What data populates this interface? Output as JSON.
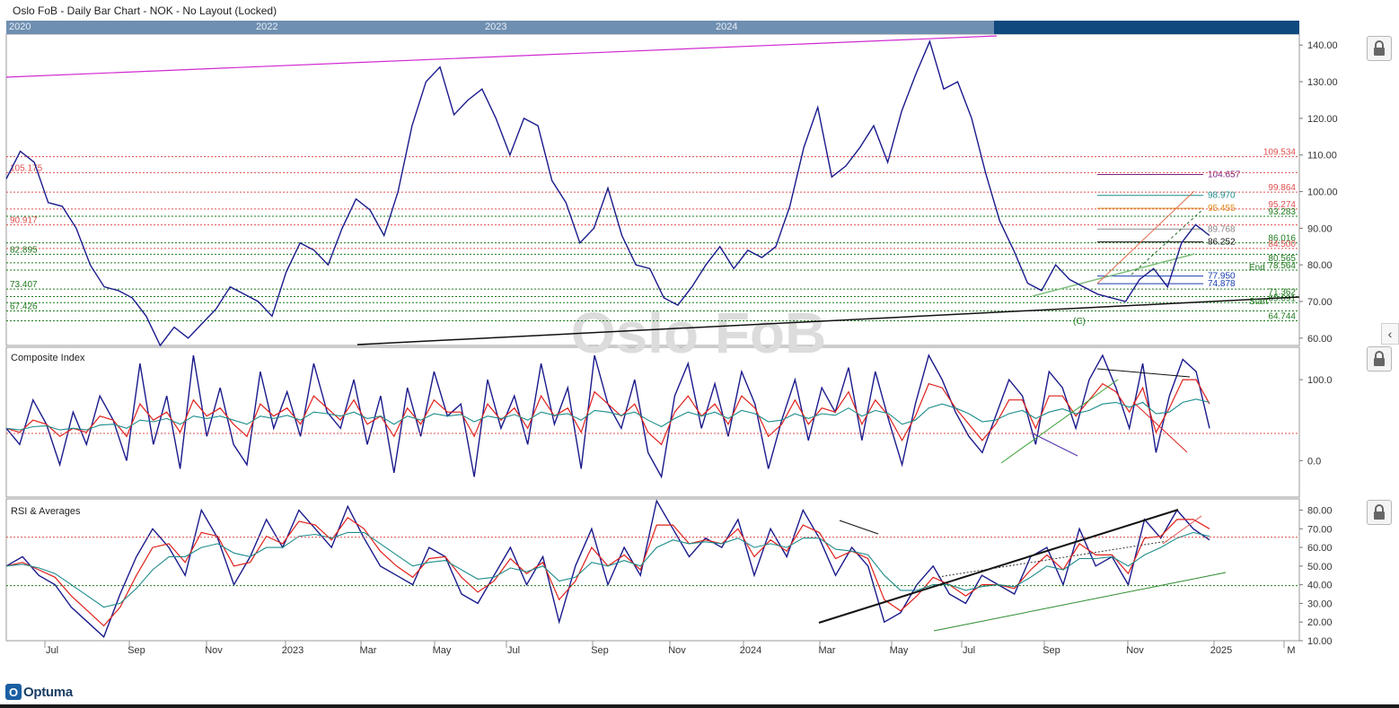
{
  "window": {
    "title": "Oslo FoB - Daily Bar Chart - NOK - No Layout (Locked)"
  },
  "overview": {
    "labels": [
      "2020",
      "2022",
      "2023",
      "2024"
    ]
  },
  "watermark": "Oslo FoB",
  "logo": {
    "text": "Optuma"
  },
  "colors": {
    "price": "#1a1a8c",
    "red_ma": "#e0201b",
    "teal_ma": "#1d8c8c",
    "magenta": "#d12ad1",
    "red_level": "#e05050",
    "green_level": "#1e7a1e",
    "trend_black": "#111111"
  },
  "chart_data": [
    {
      "type": "line",
      "panel": "price",
      "ylim": [
        58,
        143
      ],
      "yticks": [
        "60.00",
        "70.00",
        "80.00",
        "90.00",
        "100.00",
        "110.00",
        "120.00",
        "130.00",
        "140.00"
      ],
      "xticks": [
        "Jul",
        "Sep",
        "Nov",
        "2023",
        "Mar",
        "May",
        "Jul",
        "Sep",
        "Nov",
        "2024",
        "Mar",
        "May",
        "Jul",
        "Sep",
        "Nov",
        "2025",
        "M"
      ],
      "series": [
        {
          "values": [
            103.5,
            111,
            108,
            97,
            96,
            90,
            80,
            74,
            73,
            71,
            66,
            58,
            63,
            60,
            64,
            68,
            74,
            72,
            70,
            66,
            78,
            86,
            84,
            80,
            90,
            98,
            95,
            88,
            100,
            118,
            130,
            134,
            121,
            125,
            128,
            120,
            110,
            120,
            118,
            103,
            97,
            86,
            90,
            101,
            88,
            80,
            79,
            71,
            69,
            74,
            80,
            85,
            79,
            84,
            82,
            85,
            96,
            112,
            123,
            104,
            107,
            112,
            118,
            108,
            122,
            132,
            141,
            128,
            130,
            120,
            105,
            92,
            84,
            75,
            73,
            80,
            76,
            74,
            72,
            71,
            70,
            76,
            79,
            74,
            86,
            91,
            88
          ]
        }
      ],
      "levels": [
        {
          "value": 109.534,
          "label": "109.534",
          "color": "red"
        },
        {
          "value": 104.657,
          "label": "104.657",
          "color": "purple"
        },
        {
          "value": 105.175,
          "label": "105.175",
          "color": "red"
        },
        {
          "value": 99.864,
          "label": "99.864",
          "color": "red"
        },
        {
          "value": 98.97,
          "label": "98.970",
          "color": "teal"
        },
        {
          "value": 95.274,
          "label": "95.274",
          "color": "red"
        },
        {
          "value": 95.455,
          "label": "95.455",
          "color": "orange"
        },
        {
          "value": 93.283,
          "label": "93.283",
          "color": "green"
        },
        {
          "value": 90.917,
          "label": "90.917",
          "color": "red"
        },
        {
          "value": 89.768,
          "label": "89.768",
          "color": "gray"
        },
        {
          "value": 86.016,
          "label": "86.016",
          "color": "green"
        },
        {
          "value": 86.252,
          "label": "86.252",
          "color": "black"
        },
        {
          "value": 84.5,
          "label": "84.500",
          "color": "red"
        },
        {
          "value": 82.895,
          "label": "82.895",
          "color": "green"
        },
        {
          "value": 80.565,
          "label": "80.565",
          "color": "green"
        },
        {
          "value": 78.564,
          "label": "78.564",
          "color": "green"
        },
        {
          "value": 76.95,
          "label": "77.950",
          "color": "blue"
        },
        {
          "value": 74.878,
          "label": "74.878",
          "color": "blue"
        },
        {
          "value": 73.407,
          "label": "73.407",
          "color": "green"
        },
        {
          "value": 71.362,
          "label": "71.362",
          "color": "green"
        },
        {
          "value": 69.691,
          "label": "69.691",
          "color": "green"
        },
        {
          "value": 67.426,
          "label": "67.426",
          "color": "green"
        },
        {
          "value": 64.744,
          "label": "64.744",
          "color": "green"
        }
      ],
      "annotations": [
        "End",
        "Start",
        "(C)"
      ]
    },
    {
      "type": "line",
      "panel": "composite",
      "title": "Composite Index",
      "ylim": [
        -45,
        140
      ],
      "yticks": [
        "0.0",
        "100.0"
      ],
      "series": [
        {
          "values": [
            40,
            20,
            75,
            45,
            -5,
            60,
            20,
            80,
            50,
            0,
            120,
            20,
            80,
            -10,
            130,
            30,
            90,
            20,
            -5,
            110,
            40,
            85,
            30,
            120,
            60,
            40,
            100,
            20,
            80,
            -15,
            90,
            30,
            110,
            55,
            70,
            -20,
            100,
            40,
            80,
            20,
            120,
            45,
            90,
            -10,
            130,
            70,
            40,
            100,
            10,
            -20,
            80,
            120,
            40,
            95,
            30,
            110,
            70,
            -10,
            50,
            100,
            25,
            90,
            60,
            115,
            25,
            110,
            50,
            -5,
            70,
            130,
            100,
            60,
            30,
            10,
            55,
            100,
            80,
            20,
            110,
            90,
            40,
            100,
            130,
            90,
            40,
            120,
            10,
            80,
            125,
            110,
            40
          ]
        },
        {
          "values": [
            40,
            35,
            50,
            45,
            30,
            40,
            35,
            55,
            50,
            30,
            70,
            50,
            60,
            35,
            75,
            55,
            65,
            45,
            30,
            70,
            55,
            65,
            45,
            80,
            65,
            50,
            75,
            45,
            55,
            30,
            65,
            45,
            75,
            60,
            60,
            30,
            70,
            50,
            65,
            40,
            80,
            55,
            65,
            35,
            85,
            70,
            55,
            70,
            35,
            20,
            60,
            80,
            55,
            70,
            45,
            80,
            65,
            30,
            45,
            75,
            45,
            65,
            60,
            85,
            45,
            75,
            55,
            25,
            55,
            95,
            90,
            65,
            45,
            25,
            45,
            75,
            75,
            40,
            80,
            80,
            55,
            75,
            95,
            85,
            60,
            90,
            35,
            65,
            100,
            100,
            70
          ]
        },
        {
          "values": [
            40,
            38,
            42,
            43,
            38,
            40,
            38,
            44,
            45,
            40,
            50,
            48,
            52,
            45,
            55,
            52,
            55,
            50,
            45,
            55,
            52,
            56,
            50,
            60,
            58,
            55,
            60,
            52,
            55,
            45,
            55,
            50,
            58,
            55,
            57,
            48,
            55,
            52,
            57,
            50,
            60,
            56,
            58,
            50,
            62,
            60,
            56,
            60,
            50,
            42,
            52,
            60,
            55,
            60,
            52,
            62,
            58,
            48,
            50,
            58,
            52,
            58,
            56,
            65,
            55,
            62,
            58,
            45,
            50,
            65,
            70,
            65,
            58,
            48,
            50,
            58,
            62,
            52,
            60,
            64,
            58,
            62,
            70,
            72,
            66,
            72,
            58,
            60,
            72,
            76,
            72
          ]
        }
      ]
    },
    {
      "type": "line",
      "panel": "rsi",
      "title": "RSI & Averages",
      "ylim": [
        10,
        86
      ],
      "yticks": [
        "10.00",
        "20.00",
        "30.00",
        "40.00",
        "50.00",
        "60.00",
        "70.00",
        "80.00"
      ],
      "series": [
        {
          "values": [
            50,
            55,
            45,
            40,
            28,
            20,
            12,
            35,
            55,
            70,
            60,
            45,
            80,
            65,
            40,
            55,
            75,
            60,
            80,
            70,
            60,
            82,
            65,
            50,
            45,
            40,
            60,
            55,
            35,
            30,
            45,
            60,
            40,
            55,
            20,
            50,
            70,
            40,
            60,
            45,
            85,
            70,
            55,
            65,
            60,
            75,
            45,
            70,
            55,
            80,
            65,
            45,
            60,
            50,
            20,
            25,
            40,
            50,
            35,
            30,
            45,
            40,
            35,
            55,
            60,
            40,
            70,
            50,
            55,
            40,
            75,
            65,
            80,
            70,
            64
          ]
        },
        {
          "values": [
            50,
            52,
            48,
            44,
            34,
            26,
            18,
            28,
            45,
            60,
            62,
            52,
            68,
            66,
            50,
            52,
            66,
            62,
            74,
            72,
            64,
            76,
            70,
            58,
            50,
            44,
            54,
            55,
            44,
            36,
            42,
            54,
            46,
            52,
            32,
            42,
            60,
            50,
            56,
            48,
            72,
            72,
            62,
            64,
            62,
            70,
            55,
            64,
            58,
            72,
            68,
            54,
            58,
            54,
            32,
            26,
            34,
            44,
            40,
            34,
            40,
            40,
            38,
            48,
            56,
            48,
            62,
            56,
            56,
            46,
            65,
            66,
            75,
            75,
            70
          ]
        },
        {
          "values": [
            50,
            51,
            49,
            46,
            40,
            34,
            28,
            30,
            38,
            48,
            55,
            55,
            60,
            62,
            57,
            55,
            60,
            60,
            66,
            67,
            65,
            68,
            68,
            62,
            56,
            50,
            52,
            53,
            48,
            43,
            44,
            49,
            47,
            50,
            42,
            44,
            52,
            50,
            53,
            50,
            60,
            64,
            62,
            63,
            62,
            65,
            60,
            62,
            60,
            65,
            65,
            59,
            58,
            56,
            45,
            37,
            37,
            40,
            40,
            37,
            39,
            40,
            39,
            44,
            50,
            48,
            54,
            54,
            55,
            50,
            56,
            60,
            65,
            68,
            66
          ]
        }
      ]
    }
  ]
}
